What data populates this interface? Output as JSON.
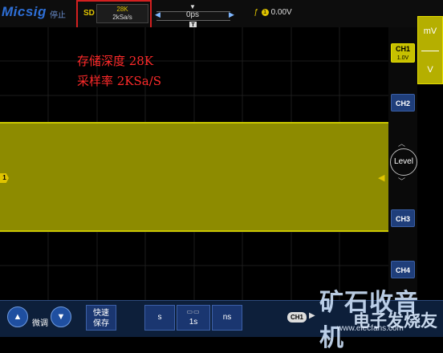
{
  "header": {
    "logo": "Micsig",
    "run_state": "停止",
    "storage_mode": "SD",
    "memory_depth": "28K",
    "sample_rate": "2kSa/s",
    "time_offset": "0ps",
    "trigger_slope": "ƒ",
    "trigger_source": "1",
    "trigger_level": "0.00V",
    "trigger_pos_marker": "▼",
    "trigger_t_marker": "T",
    "left_arrow": "◀",
    "right_arrow": "▶"
  },
  "annotations": {
    "line1": "存储深度 28K",
    "line2": "采样率  2KSa/S"
  },
  "scope": {
    "ch1_marker": "1",
    "trigger_level_marker": "◀",
    "waveform_color": "#8d8b00"
  },
  "right_panel": {
    "ch1_label": "CH1",
    "ch1_scale": "1.0V",
    "ch2_label": "CH2",
    "ch3_label": "CH3",
    "ch4_label": "CH4",
    "level_label": "Level",
    "level_up": "︿",
    "level_down": "﹀"
  },
  "units": {
    "mv": "mV",
    "v": "V"
  },
  "bottom": {
    "up_arrow": "▲",
    "down_arrow": "▼",
    "fine_label": "微调",
    "quick_save_line1": "快速",
    "quick_save_line2": "保存",
    "s_label": "s",
    "time_icon": "▭▭",
    "time_value": "1s",
    "ns_label": "ns",
    "ch1_label": "CH1",
    "ch1_arrow": "▶"
  },
  "watermark": {
    "line1": "矿石收音机",
    "line2": "电子发烧友",
    "url": "www.elecfans.com"
  },
  "colors": {
    "ch1": "#e0c400",
    "accent_blue": "#1f3e7a",
    "annotation_red": "#ff2a2a",
    "highlight_red": "#d42020"
  }
}
